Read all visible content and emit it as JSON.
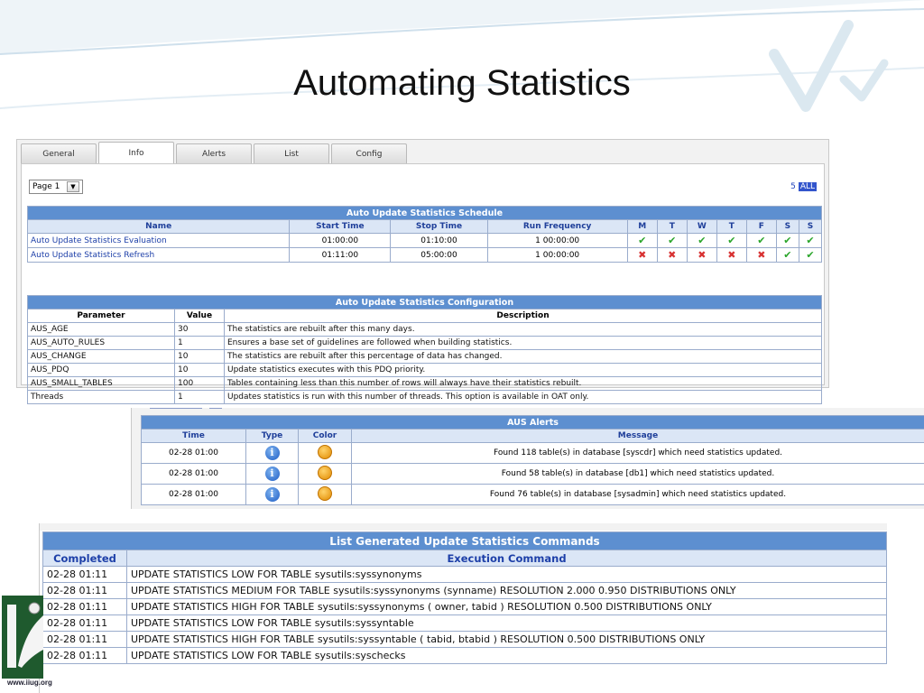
{
  "slide": {
    "title": "Automating Statistics",
    "footer_logo_text": "www.iiug.org"
  },
  "tabs": [
    {
      "label": "General",
      "active": false
    },
    {
      "label": "Info",
      "active": true
    },
    {
      "label": "Alerts",
      "active": false
    },
    {
      "label": "List",
      "active": false
    },
    {
      "label": "Config",
      "active": false
    }
  ],
  "pager": {
    "selected": "Page 1",
    "count": "5",
    "all_label": "ALL"
  },
  "schedule": {
    "caption": "Auto Update Statistics Schedule",
    "headers": [
      "Name",
      "Start Time",
      "Stop Time",
      "Run Frequency",
      "M",
      "T",
      "W",
      "T",
      "F",
      "S",
      "S"
    ],
    "rows": [
      {
        "name": "Auto Update Statistics Evaluation",
        "start": "01:00:00",
        "stop": "01:10:00",
        "freq": "1 00:00:00",
        "days": [
          "check",
          "check",
          "check",
          "check",
          "check",
          "check",
          "check"
        ]
      },
      {
        "name": "Auto Update Statistics Refresh",
        "start": "01:11:00",
        "stop": "05:00:00",
        "freq": "1 00:00:00",
        "days": [
          "cross",
          "cross",
          "cross",
          "cross",
          "cross",
          "check",
          "check"
        ]
      }
    ]
  },
  "configuration": {
    "caption": "Auto Update Statistics Configuration",
    "headers": [
      "Parameter",
      "Value",
      "Description"
    ],
    "rows": [
      [
        "AUS_AGE",
        "30",
        "The statistics are rebuilt after this many days."
      ],
      [
        "AUS_AUTO_RULES",
        "1",
        "Ensures a base set of guidelines are followed when building statistics."
      ],
      [
        "AUS_CHANGE",
        "10",
        "The statistics are rebuilt after this percentage of data has changed."
      ],
      [
        "AUS_PDQ",
        "10",
        "Update statistics executes with this PDQ priority."
      ],
      [
        "AUS_SMALL_TABLES",
        "100",
        "Tables containing less than this number of rows will always have their statistics rebuilt."
      ],
      [
        "Threads",
        "1",
        "Updates statistics is run with this number of threads. This option is available in OAT only."
      ]
    ]
  },
  "alerts": {
    "caption": "AUS Alerts",
    "headers": [
      "Time",
      "Type",
      "Color",
      "Message"
    ],
    "rows": [
      {
        "time": "02-28 01:00",
        "type_icon": "info-icon",
        "color_icon": "orange-dot-icon",
        "message": "Found 118 table(s) in database [syscdr] which need statistics updated."
      },
      {
        "time": "02-28 01:00",
        "type_icon": "info-icon",
        "color_icon": "orange-dot-icon",
        "message": "Found 58 table(s) in database [db1] which need statistics updated."
      },
      {
        "time": "02-28 01:00",
        "type_icon": "info-icon",
        "color_icon": "orange-dot-icon",
        "message": "Found 76 table(s) in database [sysadmin] which need statistics updated."
      }
    ]
  },
  "commands": {
    "caption": "List Generated Update Statistics Commands",
    "headers": [
      "Completed",
      "Execution Command"
    ],
    "rows": [
      [
        "02-28 01:11",
        "UPDATE STATISTICS LOW FOR TABLE sysutils:syssynonyms"
      ],
      [
        "02-28 01:11",
        "UPDATE STATISTICS MEDIUM FOR TABLE sysutils:syssynonyms (synname) RESOLUTION 2.000 0.950 DISTRIBUTIONS ONLY"
      ],
      [
        "02-28 01:11",
        "UPDATE STATISTICS HIGH FOR TABLE sysutils:syssynonyms ( owner, tabid ) RESOLUTION 0.500 DISTRIBUTIONS ONLY"
      ],
      [
        "02-28 01:11",
        "UPDATE STATISTICS LOW FOR TABLE sysutils:syssyntable"
      ],
      [
        "02-28 01:11",
        "UPDATE STATISTICS HIGH FOR TABLE sysutils:syssyntable ( tabid, btabid ) RESOLUTION 0.500 DISTRIBUTIONS ONLY"
      ],
      [
        "02-28 01:11",
        "UPDATE STATISTICS LOW FOR TABLE sysutils:syschecks"
      ]
    ]
  },
  "colors": {
    "header_blue": "#5d8fd0",
    "header_light": "#dbe6f6",
    "link_blue": "#1d3fa8",
    "check_green": "#2aa52a",
    "cross_red": "#d83232"
  }
}
